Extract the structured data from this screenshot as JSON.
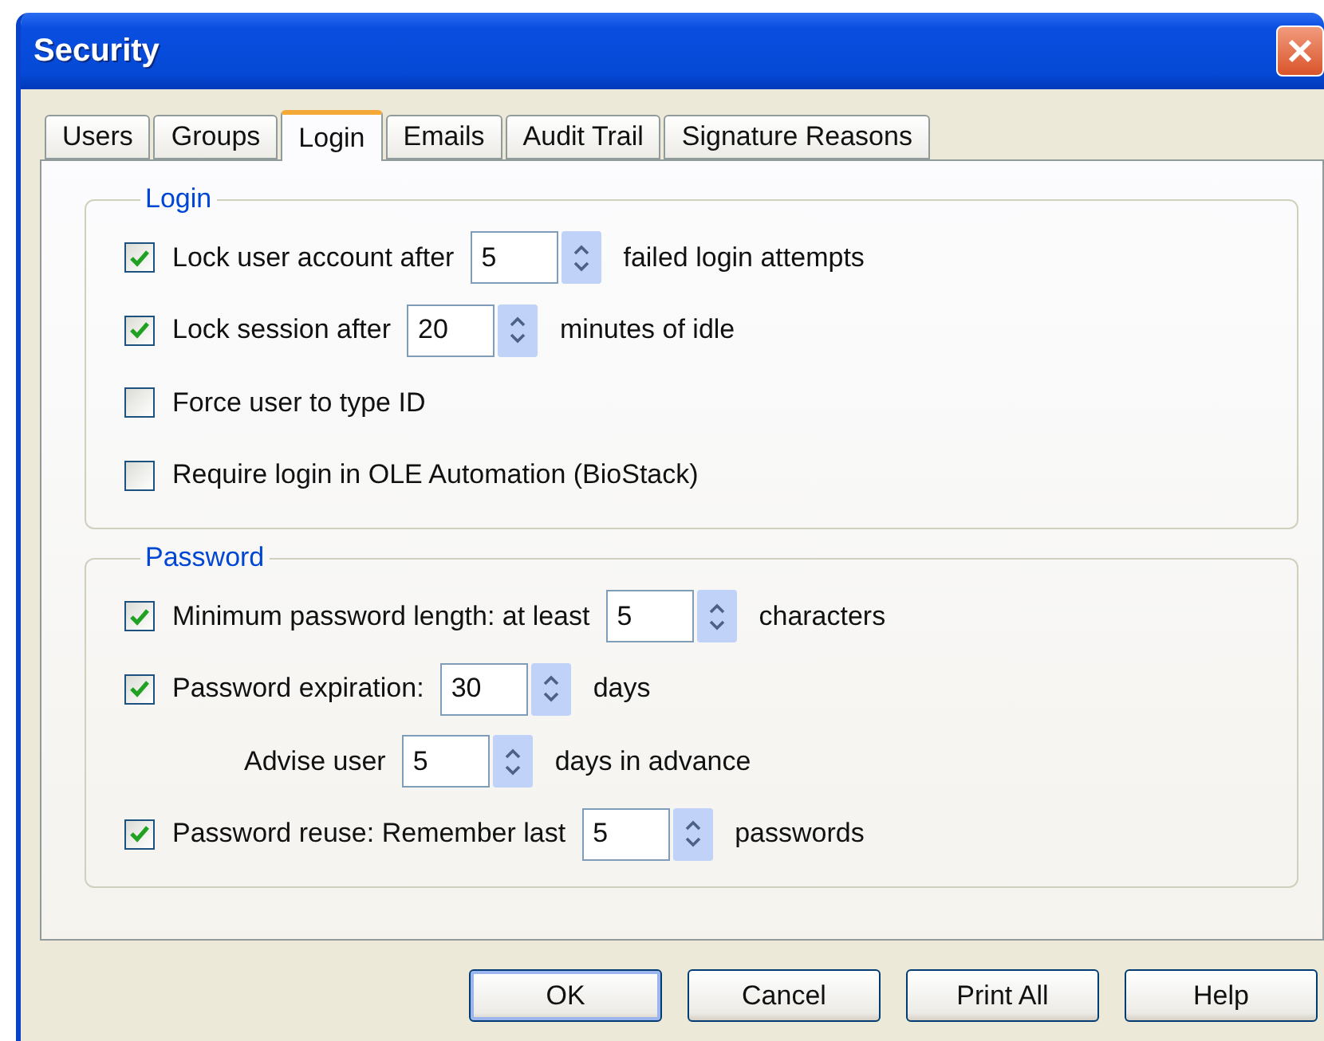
{
  "window": {
    "title": "Security"
  },
  "tabs": [
    {
      "label": "Users",
      "selected": false
    },
    {
      "label": "Groups",
      "selected": false
    },
    {
      "label": "Login",
      "selected": true
    },
    {
      "label": "Emails",
      "selected": false
    },
    {
      "label": "Audit Trail",
      "selected": false
    },
    {
      "label": "Signature Reasons",
      "selected": false
    }
  ],
  "groups": [
    {
      "title": "Login",
      "rows": [
        {
          "kind": "check",
          "checked": true,
          "label": "Lock user account after",
          "value": "5",
          "suffix": "failed login attempts"
        },
        {
          "kind": "check",
          "checked": true,
          "label": "Lock session after",
          "value": "20",
          "suffix": "minutes of idle"
        },
        {
          "kind": "check",
          "checked": false,
          "label": "Force user to type ID"
        },
        {
          "kind": "check",
          "checked": false,
          "label": "Require login in OLE Automation (BioStack)"
        }
      ]
    },
    {
      "title": "Password",
      "rows": [
        {
          "kind": "check",
          "checked": true,
          "label": "Minimum password length: at least",
          "value": "5",
          "suffix": "characters"
        },
        {
          "kind": "check",
          "checked": true,
          "label": "Password expiration:",
          "value": "30",
          "suffix": "days"
        },
        {
          "kind": "plain",
          "label": "Advise user",
          "value": "5",
          "suffix": "days in advance"
        },
        {
          "kind": "check",
          "checked": true,
          "label": "Password reuse: Remember last",
          "value": "5",
          "suffix": "passwords"
        }
      ]
    }
  ],
  "buttons": [
    {
      "label": "OK",
      "default": true
    },
    {
      "label": "Cancel",
      "default": false
    },
    {
      "label": "Print All",
      "default": false
    },
    {
      "label": "Help",
      "default": false
    }
  ]
}
